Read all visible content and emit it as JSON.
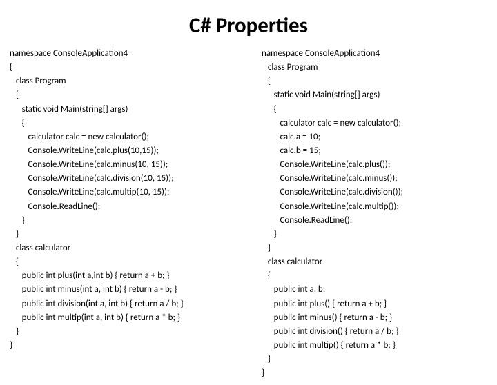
{
  "title": "C# Properties",
  "left": {
    "lines": [
      "namespace ConsoleApplication4",
      "{",
      "   class Program",
      "   {",
      "      static void Main(string[] args)",
      "      {",
      "         calculator calc = new calculator();",
      "         Console.WriteLine(calc.plus(10,15));",
      "         Console.WriteLine(calc.minus(10, 15));",
      "         Console.WriteLine(calc.division(10, 15));",
      "         Console.WriteLine(calc.multip(10, 15));",
      "         Console.ReadLine();",
      "      }",
      "   }",
      "   class calculator",
      "   {",
      "      public int plus(int a,int b) { return a + b; }",
      "      public int minus(int a, int b) { return a - b; }",
      "      public int division(int a, int b) { return a / b; }",
      "      public int multip(int a, int b) { return a * b; }",
      "   }",
      "}"
    ]
  },
  "right": {
    "lines": [
      "namespace ConsoleApplication4",
      "   class Program",
      "   {",
      "      static void Main(string[] args)",
      "      {",
      "         calculator calc = new calculator();",
      "         calc.a = 10;",
      "         calc.b = 15;",
      "         Console.WriteLine(calc.plus());",
      "         Console.WriteLine(calc.minus());",
      "         Console.WriteLine(calc.division());",
      "         Console.WriteLine(calc.multip());",
      "         Console.ReadLine();",
      "      }",
      "   }",
      "   class calculator",
      "   {",
      "      public int a, b;",
      "      public int plus() { return a + b; }",
      "      public int minus() { return a - b; }",
      "      public int division() { return a / b; }",
      "      public int multip() { return a * b; }",
      "   }",
      "}"
    ]
  }
}
